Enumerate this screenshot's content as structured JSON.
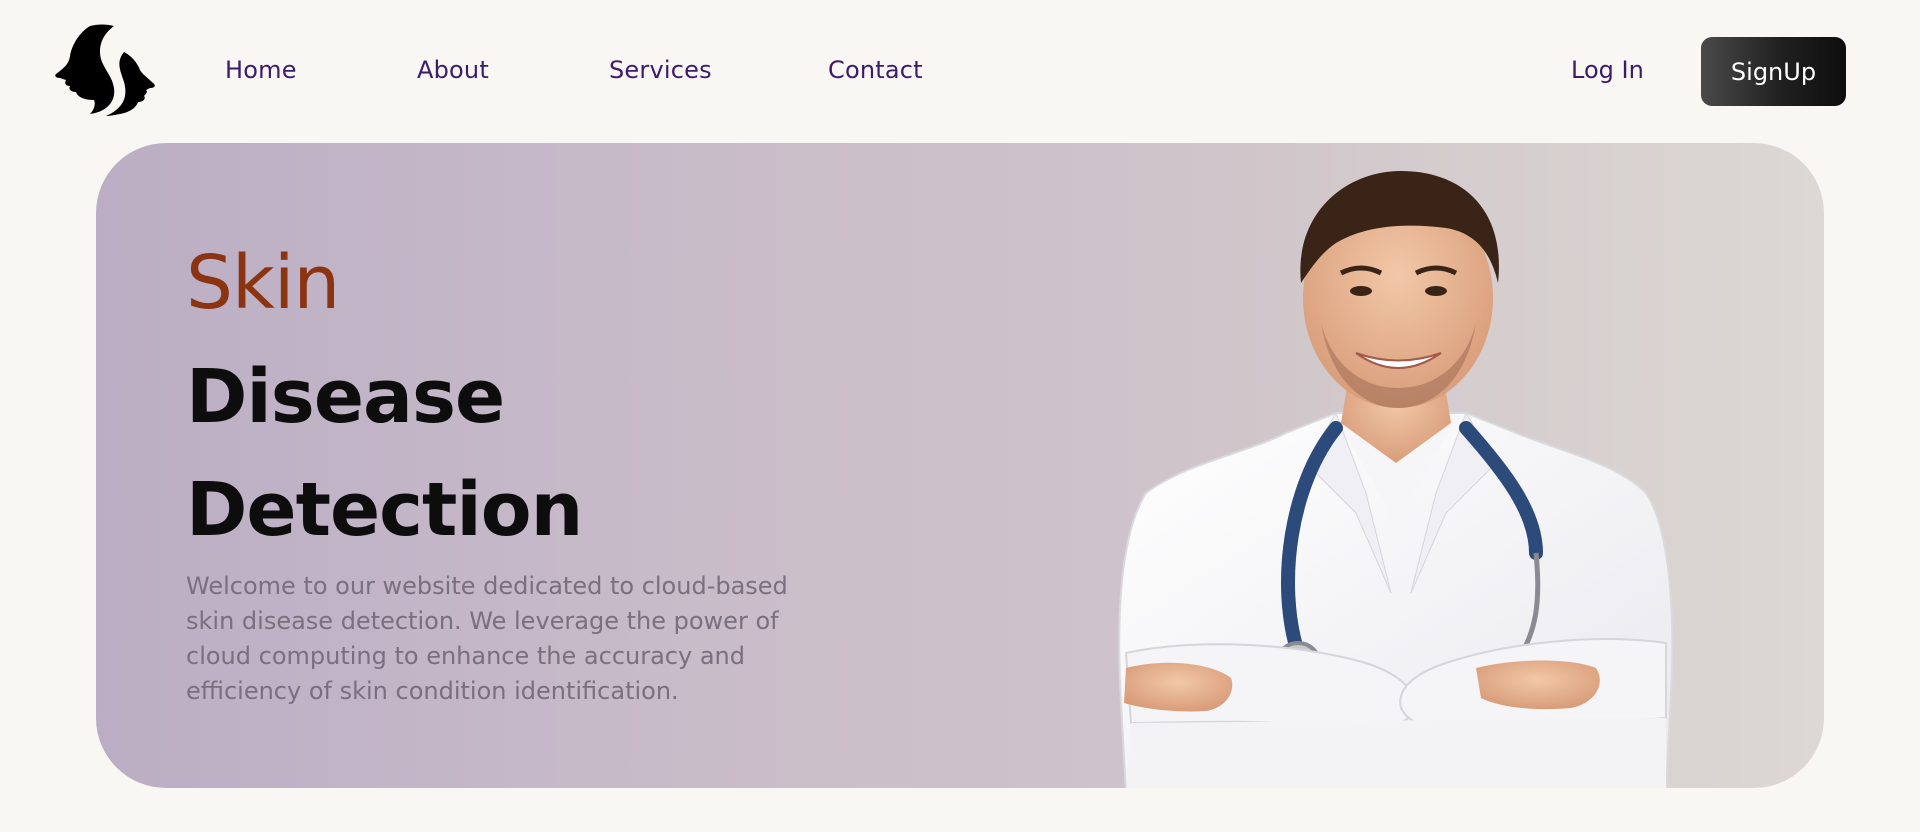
{
  "brand": {
    "logo_icon": "two-faces-profile-logo-icon"
  },
  "nav": {
    "items": [
      {
        "label": "Home"
      },
      {
        "label": "About"
      },
      {
        "label": "Services"
      },
      {
        "label": "Contact"
      }
    ],
    "login_label": "Log In",
    "signup_label": "SignUp"
  },
  "hero": {
    "title_line1": "Skin",
    "title_line2": "Disease",
    "title_line3": "Detection",
    "description": "Welcome to our website dedicated to cloud-based skin disease detection. We leverage the power of cloud computing to enhance the accuracy and efficiency of skin condition identification.",
    "image_icon": "doctor-illustration"
  },
  "colors": {
    "page_bg": "#f8f7f4",
    "nav_text": "#3d1a6b",
    "accent_title": "#8b3412",
    "signup_bg": "#1f1f1f"
  }
}
